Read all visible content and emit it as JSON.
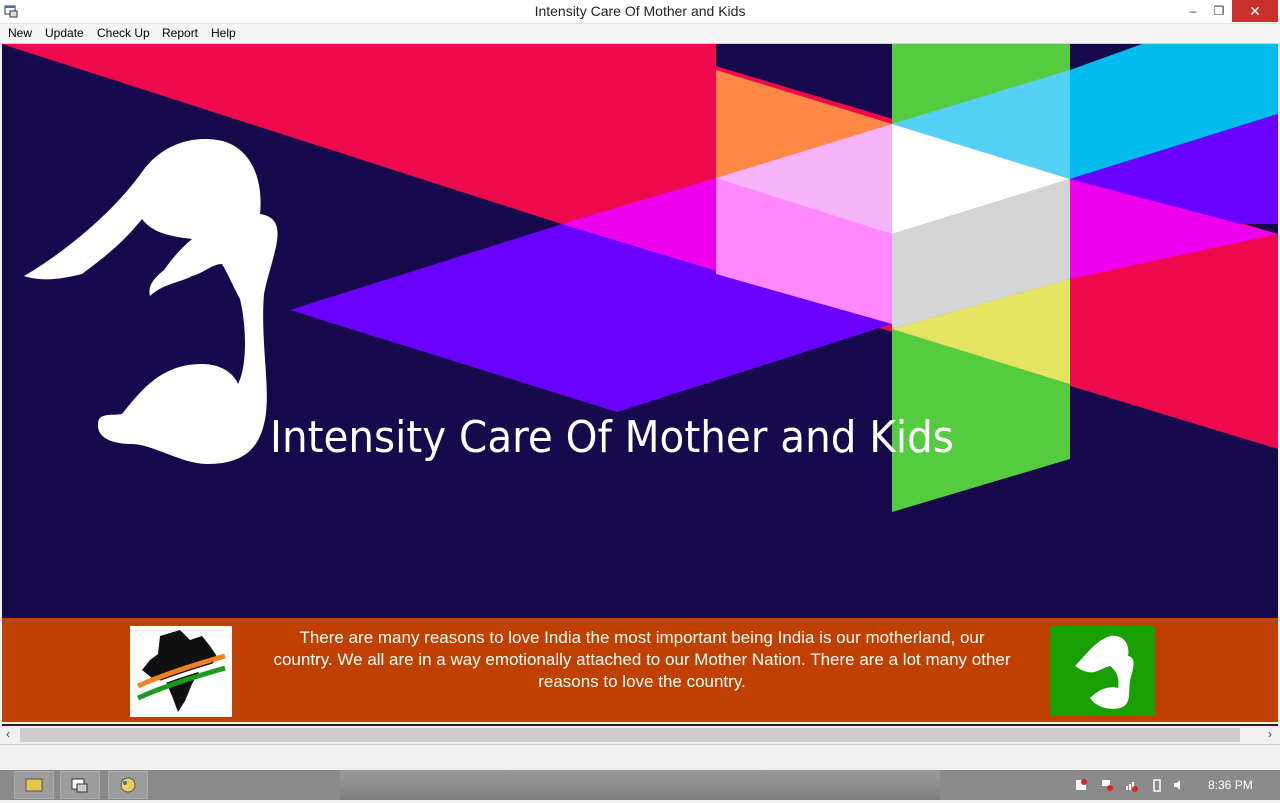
{
  "window": {
    "title": "Intensity Care Of Mother and Kids",
    "minimize_icon": "minimize-icon",
    "maximize_icon": "restore-icon",
    "close_icon": "close-icon",
    "minimize_glyph": "–",
    "maximize_glyph": "❐",
    "close_glyph": "✕"
  },
  "menu": {
    "items": [
      "New",
      "Update",
      "Check Up",
      "Report",
      "Help"
    ]
  },
  "banner": {
    "title": "Intensity Care Of Mother and Kids",
    "colors": {
      "background": "#170a4c",
      "red": "#ee0a4d",
      "violet": "#6a00ff",
      "magenta": "#ee00ee",
      "green": "#55cc3f",
      "cyan": "#00bbee",
      "orange": "#ff8844"
    }
  },
  "footer": {
    "text": "There are many reasons to love India the most important being India is our motherland, our country. We all are in a way emotionally attached to our Mother Nation. There are a lot many other reasons to love the country.",
    "background": "#c04000"
  },
  "scrollbar": {
    "left_glyph": "‹",
    "right_glyph": "›"
  },
  "taskbar": {
    "clock": "8:36 PM"
  }
}
